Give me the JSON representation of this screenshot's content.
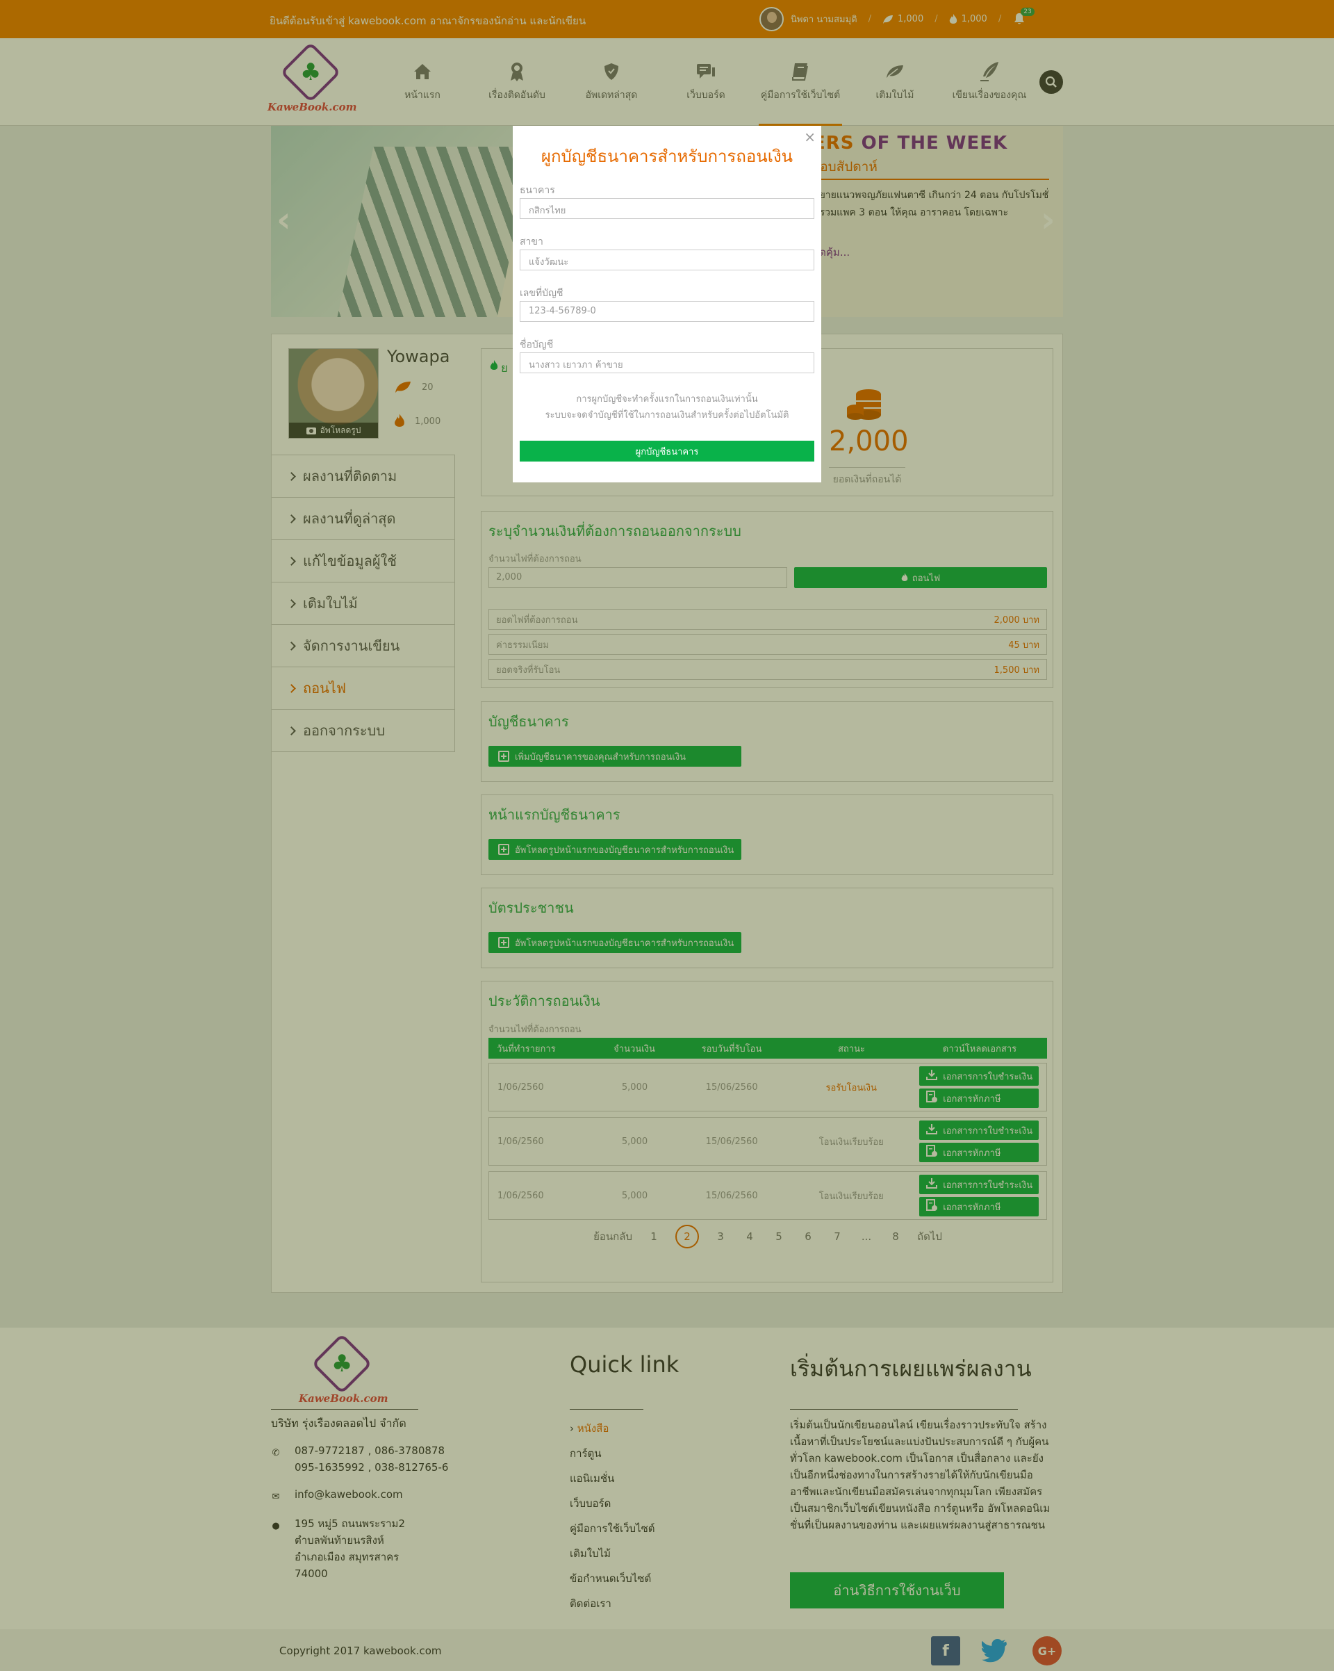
{
  "topbar": {
    "welcome": "ยินดีต้อนรับเข้าสู่ kawebook.com อาณาจักรของนักอ่าน และนักเขียน",
    "user_name": "นิพดา นามสมมุติ",
    "leaf_count": "1,000",
    "fire_count": "1,000",
    "notification_count": "23"
  },
  "logo": {
    "text": "KaweBook.com"
  },
  "nav": {
    "items": [
      {
        "label": "หน้าแรก",
        "icon": "home-icon"
      },
      {
        "label": "เรื่องติดอันดับ",
        "icon": "award-icon"
      },
      {
        "label": "อัพเดทล่าสุด",
        "icon": "shield-icon"
      },
      {
        "label": "เว็บบอร์ด",
        "icon": "chat-icon"
      },
      {
        "label": "คู่มือการใช้เว็บไซต์",
        "icon": "book-icon"
      },
      {
        "label": "เติมใบไม้",
        "icon": "leaf-icon"
      },
      {
        "label": "เขียนเรื่องของคุณ",
        "icon": "quill-icon"
      }
    ],
    "active_index": 4
  },
  "banner": {
    "title_part1": "ERS",
    "title_part2": "OF THE WEEK",
    "subtitle": "รอบสัปดาห์",
    "desc": "นิยายแนวพจญภัยแฟนตาซี เกินกว่า 24 ตอน กับโปรโมชั่นรวมแพค 3 ตอน ให้คุณ อาราคอน โดยเฉพาะ",
    "more": "สุดคุ้ม..."
  },
  "profile": {
    "name": "Yowapa",
    "leaf": "20",
    "fire": "1,000",
    "upload_label": "อัพโหลดรูป"
  },
  "side_menu": {
    "items": [
      "ผลงานที่ติดตาม",
      "ผลงานที่ดูล่าสุด",
      "แก้ไขข้อมูลผู้ใช้",
      "เติมใบไม้",
      "จัดการงานเขียน",
      "ถอนไฟ",
      "ออกจากระบบ"
    ],
    "active_index": 5
  },
  "balance": {
    "amount": "2,000",
    "label": "ยอดเงินที่ถอนได้",
    "header_fragment": "ย"
  },
  "withdraw": {
    "title": "ระบุจำนวนเงินที่ต้องการถอนออกจากระบบ",
    "amount_label": "จำนวนไฟที่ต้องการถอน",
    "amount_value": "2,000",
    "button": "ถอนไฟ",
    "rows": [
      {
        "label": "ยอดไฟที่ต้องการถอน",
        "value": "2,000 บาท"
      },
      {
        "label": "ค่าธรรมเนียม",
        "value": "45 บาท"
      },
      {
        "label": "ยอดจริงที่รับโอน",
        "value": "1,500 บาท"
      }
    ]
  },
  "bank_account": {
    "title": "บัญชีธนาคาร",
    "button": "เพิ่มบัญชีธนาคารของคุณสำหรับการถอนเงิน"
  },
  "bank_front": {
    "title": "หน้าแรกบัญชีธนาคาร",
    "button": "อัพโหลดรูปหน้าแรกของบัญชีธนาคารสำหรับการถอนเงิน"
  },
  "id_card": {
    "title": "บัตรประชาชน",
    "button": "อัพโหลดรูปหน้าแรกของบัญชีธนาคารสำหรับการถอนเงิน"
  },
  "history": {
    "title": "ประวัติการถอนเงิน",
    "subtitle": "จำนวนไฟที่ต้องการถอน",
    "columns": [
      "วันที่ทำรายการ",
      "จำนวนเงิน",
      "รอบวันที่รับโอน",
      "สถานะ",
      "ดาวน์โหลดเอกสาร"
    ],
    "rows": [
      {
        "date": "1/06/2560",
        "amount": "5,000",
        "round": "15/06/2560",
        "status": "รอรับโอนเงิน",
        "pending": true
      },
      {
        "date": "1/06/2560",
        "amount": "5,000",
        "round": "15/06/2560",
        "status": "โอนเงินเรียบร้อย",
        "pending": false
      },
      {
        "date": "1/06/2560",
        "amount": "5,000",
        "round": "15/06/2560",
        "status": "โอนเงินเรียบร้อย",
        "pending": false
      }
    ],
    "doc_receipt": "เอกสารการใบชำระเงิน",
    "doc_tax": "เอกสารหักภาษี",
    "pager": {
      "prev": "ย้อนกลับ",
      "next": "ถัดไป",
      "pages": [
        "1",
        "2",
        "3",
        "4",
        "5",
        "6",
        "7",
        "...",
        "8"
      ],
      "current": "2"
    }
  },
  "modal": {
    "title": "ผูกบัญชีธนาคารสำหรับการถอนเงิน",
    "close": "×",
    "bank_label": "ธนาคาร",
    "bank_value": "กสิกรไทย",
    "branch_label": "สาขา",
    "branch_value": "แจ้งวัฒนะ",
    "account_no_label": "เลขที่บัญชี",
    "account_no_value": "123-4-56789-0",
    "account_name_label": "ชื่อบัญชี",
    "account_name_value": "นางสาว เยาวภา ค้าขาย",
    "note1": "การผูกบัญชีจะทำครั้งแรกในการถอนเงินเท่านั้น",
    "note2": "ระบบจะจดจำบัญชีที่ใช้ในการถอนเงินสำหรับครั้งต่อไปอัตโนมัติ",
    "submit": "ผูกบัญชีธนาคาร"
  },
  "footer": {
    "company": "บริษัท รุ่งเรืองตลอดไป จำกัด",
    "phone1": "087-9772187 , 086-3780878",
    "phone2": "095-1635992 , 038-812765-6",
    "email": "info@kawebook.com",
    "address": [
      "195 หมู่5 ถนนพระราม2",
      "ตำบลพันท้ายนรสิงห์",
      "อำเภอเมือง สมุทรสาคร",
      "74000"
    ],
    "quicklink_title": "Quick link",
    "links": [
      "หนังสือ",
      "การ์ตูน",
      "แอนิเมชั่น",
      "เว็บบอร์ด",
      "คู่มือการใช้เว็บไซต์",
      "เติมใบไม้",
      "ข้อกำหนดเว็บไซต์",
      "ติดต่อเรา"
    ],
    "start_title": "เริ่มต้นการเผยแพร่ผลงาน",
    "start_text": "เริ่มต้นเป็นนักเขียนออนไลน์ เขียนเรื่องราวประทับใจ สร้างเนื้อหาที่เป็นประโยชน์และแบ่งปันประสบการณ์ดี ๆ กับผู้คนทั่วโลก kawebook.com เป็นโอกาส เป็นสื่อกลาง และยังเป็นอีกหนึ่งช่องทางในการสร้างรายได้ให้กับนักเขียนมืออาชีพและนักเขียนมือสมัครเล่นจากทุกมุมโลก เพียงสมัครเป็นสมาชิกเว็บไซต์เขียนหนังสือ การ์ตูนหรือ อัพโหลดอนิเมชั่นที่เป็นผลงานของท่าน และเผยแพร่ผลงานสู่สาธารณชน",
    "start_button": "อ่านวิธีการใช้งานเว็บ",
    "copyright": "Copyright 2017 kawebook.com"
  },
  "colors": {
    "orange": "#f07e00",
    "green": "#09b24a",
    "purple": "#7b2c8f",
    "overlay": "rgba(60,70,0,.38)"
  }
}
